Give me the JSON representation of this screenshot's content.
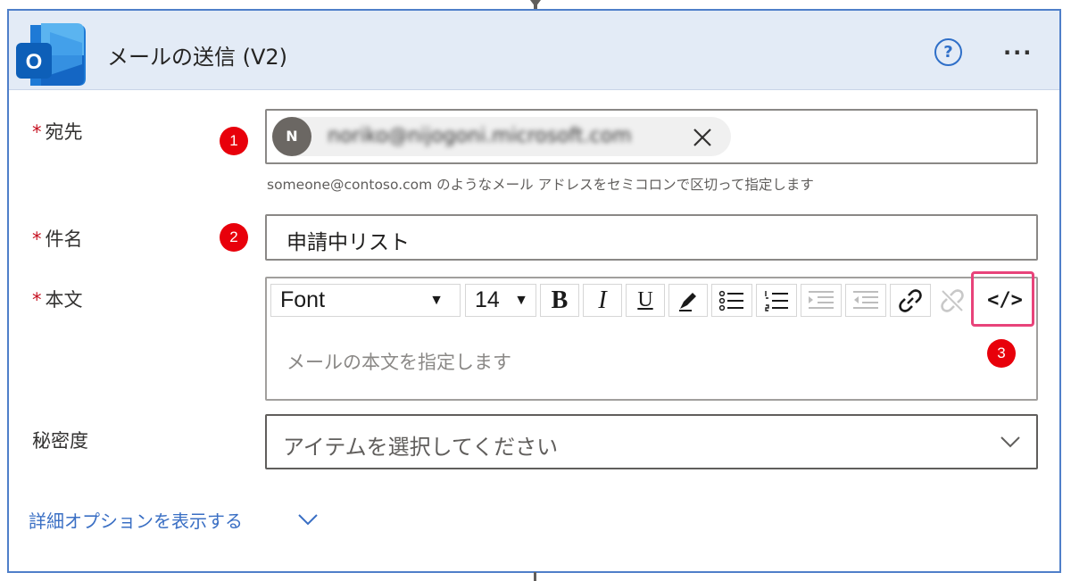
{
  "header": {
    "title": "メールの送信 (V2)",
    "app_icon_letter": "O",
    "help_glyph": "?",
    "more_glyph": "···"
  },
  "fields": {
    "to": {
      "label": "宛先",
      "required_mark": "*",
      "chip_initial": "N",
      "chip_text": "noriko@nijogoni.microsoft.com",
      "hint": "someone@contoso.com のようなメール アドレスをセミコロンで区切って指定します"
    },
    "subject": {
      "label": "件名",
      "required_mark": "*",
      "value": "申請中リスト"
    },
    "body": {
      "label": "本文",
      "required_mark": "*",
      "placeholder": "メールの本文を指定します",
      "toolbar": {
        "font": "Font",
        "size": "14",
        "bold": "B",
        "italic": "I",
        "underline": "U",
        "code_view": "</>"
      }
    },
    "sensitivity": {
      "label": "秘密度",
      "value": "アイテムを選択してください"
    }
  },
  "advanced_options": "詳細オプションを表示する",
  "markers": [
    "1",
    "2",
    "3"
  ],
  "colors": {
    "header_bg": "#e3ebf6",
    "card_border": "#4f7fc9",
    "marker_red": "#e8000b",
    "highlight_pink": "#e8437a",
    "link_blue": "#3a6fc4"
  }
}
